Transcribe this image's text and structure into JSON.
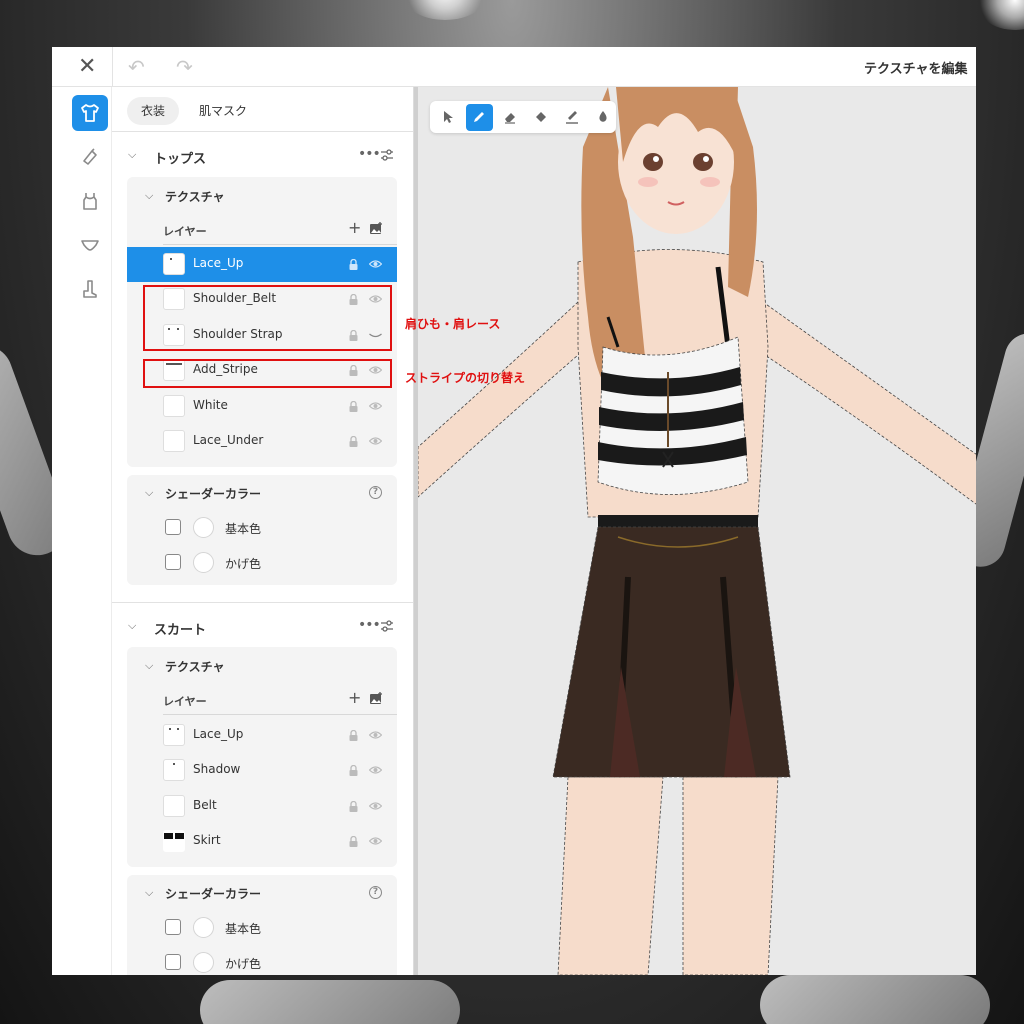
{
  "window": {
    "title": "テクスチャを編集"
  },
  "topbar": {
    "close_glyph": "✕",
    "undo_glyph": "↶",
    "redo_glyph": "↷"
  },
  "rail": {
    "items": [
      {
        "icon": "shirt-icon",
        "active": true
      },
      {
        "icon": "accessory-icon",
        "active": false
      },
      {
        "icon": "top-icon",
        "active": false
      },
      {
        "icon": "underwear-icon",
        "active": false
      },
      {
        "icon": "shoe-icon",
        "active": false
      }
    ]
  },
  "panel": {
    "tabs": [
      {
        "label": "衣装",
        "active": true
      },
      {
        "label": "肌マスク",
        "active": false
      }
    ],
    "sections": [
      {
        "title": "トップス",
        "texture": {
          "title": "テクスチャ",
          "layers_label": "レイヤー",
          "layers": [
            {
              "name": "Lace_Up",
              "selected": true
            },
            {
              "name": "Shoulder_Belt",
              "selected": false
            },
            {
              "name": "Shoulder Strap",
              "selected": false
            },
            {
              "name": "Add_Stripe",
              "selected": false
            },
            {
              "name": "White",
              "selected": false
            },
            {
              "name": "Lace_Under",
              "selected": false
            }
          ]
        },
        "shader": {
          "title": "シェーダーカラー",
          "colors": [
            {
              "label": "基本色"
            },
            {
              "label": "かげ色"
            }
          ]
        }
      },
      {
        "title": "スカート",
        "texture": {
          "title": "テクスチャ",
          "layers_label": "レイヤー",
          "layers": [
            {
              "name": "Lace_Up",
              "selected": false
            },
            {
              "name": "Shadow",
              "selected": false
            },
            {
              "name": "Belt",
              "selected": false
            },
            {
              "name": "Skirt",
              "selected": false
            }
          ]
        },
        "shader": {
          "title": "シェーダーカラー",
          "colors": [
            {
              "label": "基本色"
            },
            {
              "label": "かげ色"
            }
          ]
        }
      }
    ]
  },
  "viewport": {
    "tools": [
      {
        "icon": "select-arrow-icon",
        "active": false
      },
      {
        "icon": "pen-icon",
        "active": true
      },
      {
        "icon": "eraser-icon",
        "active": false
      },
      {
        "icon": "fill-icon",
        "active": false
      },
      {
        "icon": "stamp-icon",
        "active": false
      },
      {
        "icon": "dropper-icon",
        "active": false
      }
    ]
  },
  "annotations": {
    "shoulder": "肩ひも・肩レース",
    "stripe": "ストライプの切り替え"
  },
  "colors": {
    "accent": "#1e8fe8",
    "annotation": "#e01010",
    "hair": "#c98e62",
    "skin": "#f6dccb",
    "skirt": "#3a2a22"
  }
}
